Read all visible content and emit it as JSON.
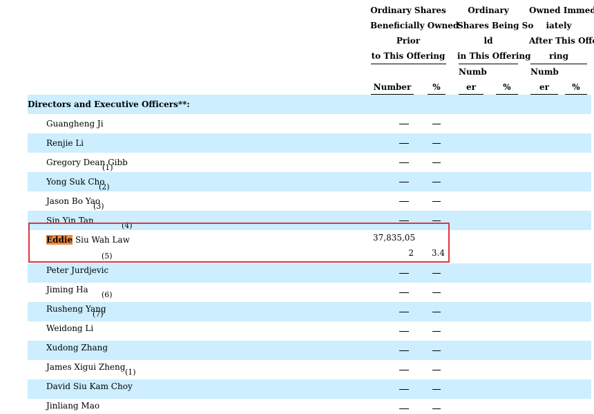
{
  "header": {
    "group1": [
      "Ordinary Shares",
      "Beneficially Owned",
      "Prior",
      "to This Offering"
    ],
    "group2": [
      "Ordinary",
      "Shares Being So",
      "ld",
      "in This Offering"
    ],
    "group3": [
      "Owned Immed",
      "iately",
      "After This Offe",
      "ring"
    ],
    "number_label": "Number",
    "percent_label": "%",
    "numb_label": "Numb",
    "er_label": "er"
  },
  "section_title": "Directors and Executive Officers**:",
  "dash": "—",
  "rows": [
    {
      "name": "Guangheng Ji",
      "footnote": ""
    },
    {
      "name": "Renjie Li",
      "footnote": ""
    },
    {
      "name": "Gregory Dean Gibb",
      "footnote": "(1)"
    },
    {
      "name": "Yong Suk Cho",
      "footnote": "(2)"
    },
    {
      "name": "Jason Bo Yao",
      "footnote": "(3)"
    },
    {
      "name": "Sin Yin Tan",
      "footnote": "(4)"
    },
    {
      "name_highlight": "Eddie",
      "name_rest": " Siu Wah Law",
      "footnote": "(5)",
      "number_line1": "37,835,05",
      "number_line2": "2",
      "percent": "3.4"
    },
    {
      "name": "Peter Jurdjevic",
      "footnote": ""
    },
    {
      "name": "Jiming Ha",
      "footnote": "(6)"
    },
    {
      "name": "Rusheng Yang",
      "footnote": "(7)"
    },
    {
      "name": "Weidong Li",
      "footnote": ""
    },
    {
      "name": "Xudong Zhang",
      "footnote": ""
    },
    {
      "name": "James Xigui Zheng",
      "footnote": "(1)"
    },
    {
      "name": "David Siu Kam Choy",
      "footnote": ""
    },
    {
      "name": "Jinliang Mao",
      "footnote": ""
    }
  ]
}
